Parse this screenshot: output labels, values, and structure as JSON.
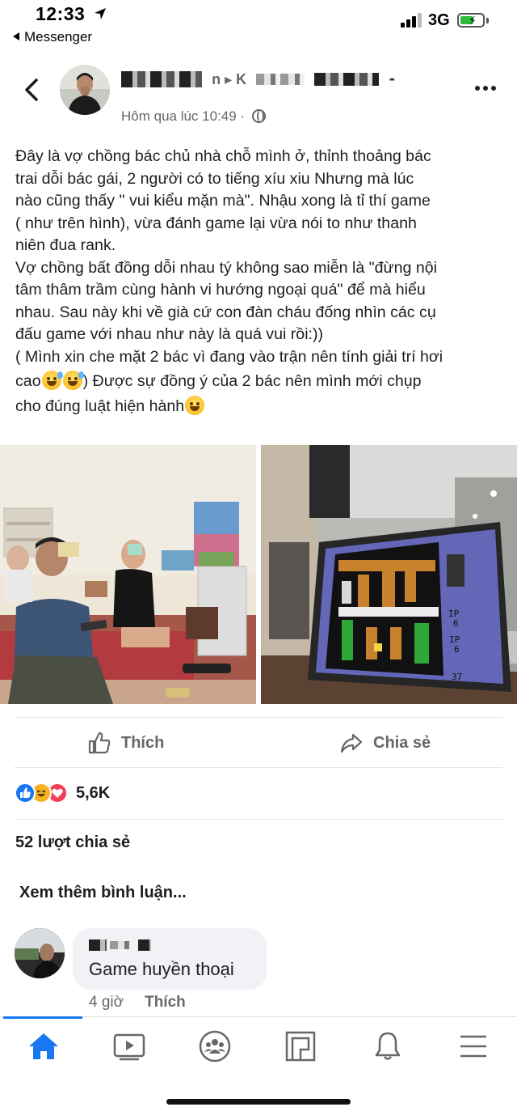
{
  "status_bar": {
    "time": "12:33",
    "back_app": "Messenger",
    "network": "3G",
    "battery_color": "#2fbb3f"
  },
  "post": {
    "author_visible_text": "n ▸ K",
    "timestamp": "Hôm qua lúc 10:49 ·",
    "privacy_icon": "globe-icon",
    "text_lines": [
      "Đây là vợ chồng bác chủ nhà chỗ mình ở, thỉnh thoảng bác",
      "trai dỗi bác gái, 2 người có to tiếng xíu xiu Nhưng mà lúc",
      "nào cũng thấy \" vui kiểu mặn mà\". Nhậu xong là tỉ thí game",
      "( như trên hình), vừa đánh game lại vừa nói to như thanh",
      "niên đua rank.",
      "Vợ chồng bất đồng dỗi nhau tý không sao miễn là \"đừng nội",
      "tâm thâm trầm cùng hành vi hướng ngoại quá\" để mà hiểu",
      "nhau. Sau này  khi về già cứ con đàn cháu đống nhìn các cụ",
      "đấu game với nhau như này là quá vui rồi:))",
      "( Mình xin che mặt 2 bác vì đang vào trận nên tính giải trí hơi"
    ],
    "line_cao_suffix": ") Được sự đồng ý của 2 bác nên mình mới chụp",
    "line_cao_prefix": "cao",
    "last_line": "cho đúng luật hiện hành",
    "game_screen_text": {
      "ip1": "IP",
      "ip1_val": "6",
      "ip2": "IP",
      "ip2_val": "6",
      "stage": "37"
    }
  },
  "actions": {
    "like_label": "Thích",
    "share_label": "Chia sẻ"
  },
  "reactions": {
    "count": "5,6K"
  },
  "shares": "52 lượt chia sẻ",
  "more_comments": "Xem thêm bình luận...",
  "comment": {
    "text": "Game huyền thoại",
    "time": "4 giờ",
    "like": "Thích"
  },
  "colors": {
    "accent": "#1877f2",
    "muted": "#65676b"
  }
}
